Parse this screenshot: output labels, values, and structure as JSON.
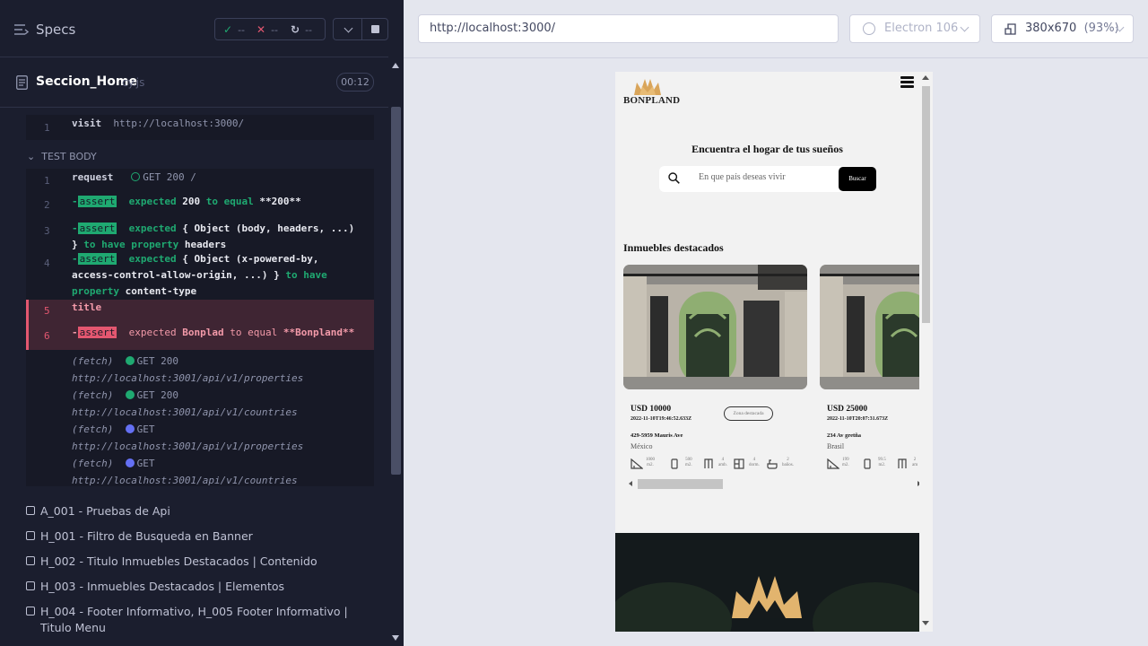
{
  "runner": {
    "specs_label": "Specs",
    "stats": {
      "passed": "--",
      "failed": "--",
      "pending": "--"
    },
    "spec": {
      "name": "Seccion_Home",
      "ext": "cy.js",
      "duration": "00:12"
    },
    "before": {
      "line": "1",
      "command": "visit",
      "arg": "http://localhost:3000/"
    },
    "test_body_label": "TEST BODY",
    "commands": [
      {
        "line": "1",
        "cmd": "request",
        "method": "GET 200 /"
      },
      {
        "line": "2",
        "badge": "assert",
        "parts": [
          "expected",
          "200",
          "to equal",
          "**200**"
        ]
      },
      {
        "line": "3",
        "badge": "assert",
        "text1": "expected",
        "val1": "{ Object (body, headers, ...)",
        "val2": "}",
        "kw2": "to have property",
        "val3": "headers"
      },
      {
        "line": "4",
        "badge": "assert",
        "text1": "expected",
        "val1": "{ Object (x-powered-by,",
        "val2": "access-control-allow-origin, ...) }",
        "kw2": "to have",
        "kw3": "property",
        "val3": "content-type"
      },
      {
        "line": "5",
        "cmd": "title"
      },
      {
        "line": "6",
        "badge": "assert",
        "parts": [
          "expected",
          "Bonplad",
          "to equal",
          "**Bonpland**"
        ]
      }
    ],
    "fetches": [
      {
        "label": "(fetch)",
        "status": "GET 200",
        "url": "http://localhost:3001/api/v1/properties"
      },
      {
        "label": "(fetch)",
        "status": "GET 200",
        "url": "http://localhost:3001/api/v1/countries"
      },
      {
        "label": "(fetch)",
        "status": "GET",
        "url": "http://localhost:3001/api/v1/properties"
      },
      {
        "label": "(fetch)",
        "status": "GET",
        "url": "http://localhost:3001/api/v1/countries"
      }
    ],
    "suites": [
      "A_001 - Pruebas de Api",
      "H_001 - Filtro de Busqueda en Banner",
      "H_002 - Titulo Inmuebles Destacados | Contenido",
      "H_003 - Inmuebles Destacados | Elementos",
      "H_004 - Footer Informativo, H_005 Footer Informativo | Titulo Menu"
    ]
  },
  "browser": {
    "url": "http://localhost:3000/",
    "browser_name": "Electron 106",
    "viewport": "380x670",
    "zoom": "(93%)"
  },
  "app": {
    "logo": "BONPLAND",
    "hero_title": "Encuentra el hogar de tus sueños",
    "search_placeholder": "En que país deseas vivir",
    "search_button": "Buscar",
    "featured_title": "Inmuebles destacados",
    "cards": [
      {
        "price": "USD 10000",
        "date": "2022-11-10T19:46:52.633Z",
        "zone": "Zona destacada",
        "address": "429-5959 Mauris Ave",
        "country": "México",
        "features": [
          {
            "icon": "area-icon",
            "value": "1000",
            "unit": "m2."
          },
          {
            "icon": "phone-icon",
            "value": "500",
            "unit": "m2."
          },
          {
            "icon": "door-icon",
            "value": "4",
            "unit": "amb."
          },
          {
            "icon": "bed-icon",
            "value": "4",
            "unit": "dorm."
          },
          {
            "icon": "bath-icon",
            "value": "2",
            "unit": "baños."
          }
        ]
      },
      {
        "price": "USD 25000",
        "date": "2022-11-10T20:07:31.673Z",
        "address": "234 Av gretña",
        "country": "Brasil",
        "features": [
          {
            "icon": "area-icon",
            "value": "199",
            "unit": "m2."
          },
          {
            "icon": "phone-icon",
            "value": "99.5",
            "unit": "m2."
          },
          {
            "icon": "door-icon",
            "value": "2",
            "unit": "am"
          }
        ]
      }
    ]
  },
  "colors": {
    "pass": "#1fa971",
    "fail": "#e45770",
    "pending": "#6470f3"
  }
}
